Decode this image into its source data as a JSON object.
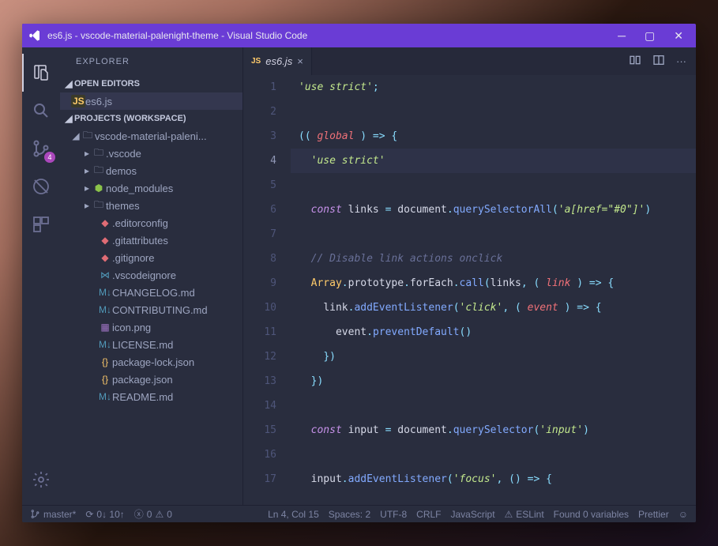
{
  "window": {
    "title": "es6.js - vscode-material-palenight-theme - Visual Studio Code"
  },
  "activitybar": {
    "badge_scm": "4"
  },
  "sidebar": {
    "title": "EXPLORER",
    "open_editors_label": "OPEN EDITORS",
    "open_editors": [
      {
        "label": "es6.js",
        "icon": "js"
      }
    ],
    "workspace_label": "PROJECTS (WORKSPACE)",
    "tree": [
      {
        "label": "vscode-material-paleni...",
        "type": "folder",
        "expanded": true,
        "depth": 1
      },
      {
        "label": ".vscode",
        "type": "folder",
        "expanded": false,
        "depth": 2
      },
      {
        "label": "demos",
        "type": "folder",
        "expanded": false,
        "depth": 2
      },
      {
        "label": "node_modules",
        "type": "nm",
        "expanded": false,
        "depth": 2
      },
      {
        "label": "themes",
        "type": "folder",
        "expanded": false,
        "depth": 2
      },
      {
        "label": ".editorconfig",
        "type": "git",
        "depth": 3
      },
      {
        "label": ".gitattributes",
        "type": "git",
        "depth": 3
      },
      {
        "label": ".gitignore",
        "type": "git",
        "depth": 3
      },
      {
        "label": ".vscodeignore",
        "type": "vs",
        "depth": 3
      },
      {
        "label": "CHANGELOG.md",
        "type": "md",
        "depth": 3
      },
      {
        "label": "CONTRIBUTING.md",
        "type": "md",
        "depth": 3
      },
      {
        "label": "icon.png",
        "type": "img",
        "depth": 3
      },
      {
        "label": "LICENSE.md",
        "type": "md",
        "depth": 3
      },
      {
        "label": "package-lock.json",
        "type": "json",
        "depth": 3
      },
      {
        "label": "package.json",
        "type": "json",
        "depth": 3
      },
      {
        "label": "README.md",
        "type": "md",
        "depth": 3
      }
    ]
  },
  "tabs": {
    "items": [
      {
        "label": "es6.js",
        "icon": "js"
      }
    ]
  },
  "code": {
    "lines": [
      {
        "n": 1,
        "html": "<span class='tok-str'>'use strict'</span><span class='tok-punct'>;</span>"
      },
      {
        "n": 2,
        "html": ""
      },
      {
        "n": 3,
        "html": "<span class='tok-punct'>(( </span><span class='tok-param'>global</span><span class='tok-punct'> ) =&gt; {</span>"
      },
      {
        "n": 4,
        "html": "  <span class='tok-str'>'use strict'</span>",
        "current": true
      },
      {
        "n": 5,
        "html": ""
      },
      {
        "n": 6,
        "html": "  <span class='tok-kw'>const</span> <span class='tok-var'>links</span> <span class='tok-punct'>=</span> <span class='tok-var'>document</span><span class='tok-punct'>.</span><span class='tok-fn'>querySelectorAll</span><span class='tok-punct'>(</span><span class='tok-str'>'a[href=&quot;#0&quot;]'</span><span class='tok-punct'>)</span>"
      },
      {
        "n": 7,
        "html": ""
      },
      {
        "n": 8,
        "html": "  <span class='tok-cmt'>// Disable link actions onclick</span>"
      },
      {
        "n": 9,
        "html": "  <span class='tok-obj'>Array</span><span class='tok-punct'>.</span><span class='tok-var'>prototype</span><span class='tok-punct'>.</span><span class='tok-var'>forEach</span><span class='tok-punct'>.</span><span class='tok-fn'>call</span><span class='tok-punct'>(</span><span class='tok-var'>links</span><span class='tok-punct'>, ( </span><span class='tok-param'>link</span><span class='tok-punct'> ) =&gt; {</span>"
      },
      {
        "n": 10,
        "html": "    <span class='tok-var'>link</span><span class='tok-punct'>.</span><span class='tok-fn'>addEventListener</span><span class='tok-punct'>(</span><span class='tok-str'>'click'</span><span class='tok-punct'>, ( </span><span class='tok-param'>event</span><span class='tok-punct'> ) =&gt; {</span>"
      },
      {
        "n": 11,
        "html": "      <span class='tok-var'>event</span><span class='tok-punct'>.</span><span class='tok-fn'>preventDefault</span><span class='tok-punct'>()</span>"
      },
      {
        "n": 12,
        "html": "    <span class='tok-punct'>})</span>"
      },
      {
        "n": 13,
        "html": "  <span class='tok-punct'>})</span>"
      },
      {
        "n": 14,
        "html": ""
      },
      {
        "n": 15,
        "html": "  <span class='tok-kw'>const</span> <span class='tok-var'>input</span> <span class='tok-punct'>=</span> <span class='tok-var'>document</span><span class='tok-punct'>.</span><span class='tok-fn'>querySelector</span><span class='tok-punct'>(</span><span class='tok-str'>'input'</span><span class='tok-punct'>)</span>"
      },
      {
        "n": 16,
        "html": ""
      },
      {
        "n": 17,
        "html": "  <span class='tok-var'>input</span><span class='tok-punct'>.</span><span class='tok-fn'>addEventListener</span><span class='tok-punct'>(</span><span class='tok-str'>'focus'</span><span class='tok-punct'>, () =&gt; {</span>"
      }
    ]
  },
  "status": {
    "branch": "master*",
    "sync": "0↓ 10↑",
    "errors": "0",
    "warnings": "0",
    "cursor": "Ln 4, Col 15",
    "spaces": "Spaces: 2",
    "encoding": "UTF-8",
    "eol": "CRLF",
    "language": "JavaScript",
    "eslint": "ESLint",
    "vars": "Found 0 variables",
    "prettier": "Prettier"
  }
}
